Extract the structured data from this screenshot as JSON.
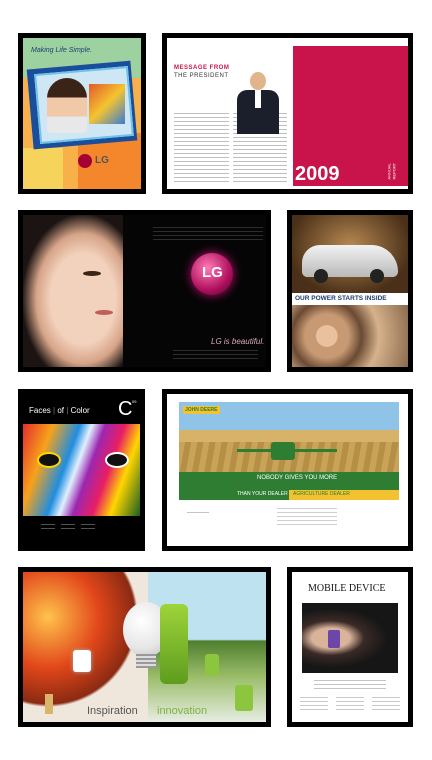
{
  "thumbnails": {
    "lg_poster": {
      "slogan": "Making Life Simple.",
      "brand": "LG"
    },
    "annual_report": {
      "heading": "MESSAGE FROM",
      "subheading": "THE PRESIDENT",
      "year": "2009",
      "side_label": "ANNUAL REPORT"
    },
    "lg_beauty": {
      "logo_letters": "LG",
      "tagline": "LG is beautiful."
    },
    "nissan": {
      "headline": "OUR POWER STARTS INSIDE"
    },
    "faces_of_color": {
      "word1": "Faces",
      "word2": "of",
      "word3": "Color",
      "letter": "C",
      "superscript": "09"
    },
    "john_deere": {
      "logo_text": "JOHN DEERE",
      "tagline": "NOBODY GIVES YOU MORE",
      "left_bar": "THAN YOUR DEALER",
      "right_bar": "AGRICULTURE DEALER"
    },
    "lg_inspiration": {
      "word_left": "Inspiration",
      "word_right": "innovation"
    },
    "mobile_device": {
      "title": "MOBILE DEVICE"
    }
  },
  "colors": {
    "frame": "#000000",
    "magenta": "#c8144a",
    "deere_green": "#2e7d32",
    "deere_yellow": "#f2c230"
  }
}
